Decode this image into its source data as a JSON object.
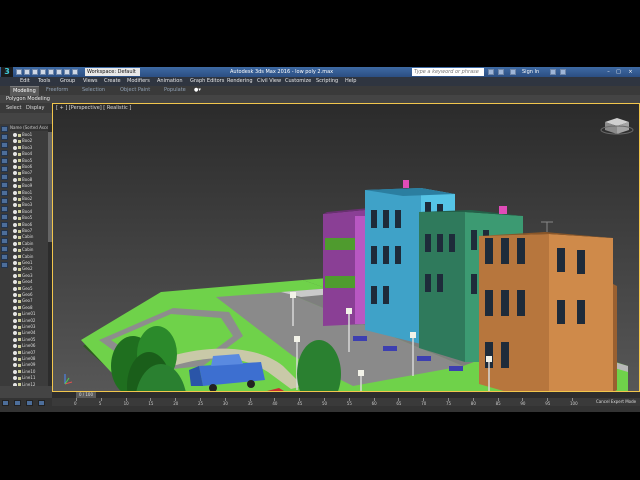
{
  "titlebar": {
    "logo": "3",
    "workspace": "Workspace: Default",
    "title": "Autodesk 3ds Max 2016 - low poly 2.max",
    "search_placeholder": "Type a keyword or phrase",
    "signin": "Sign In"
  },
  "menu": [
    "Edit",
    "Tools",
    "Group",
    "Views",
    "Create",
    "Modifiers",
    "Animation",
    "Graph Editors",
    "Rendering",
    "Civil View",
    "Customize",
    "Scripting",
    "Help"
  ],
  "ribbon": {
    "tabs": [
      "Modeling",
      "Freeform",
      "Selection",
      "Object Paint",
      "Populate"
    ],
    "panel": "Polygon Modeling"
  },
  "scene_explorer": {
    "tabs": [
      "Select",
      "Display"
    ],
    "header": "Name (Sorted Ascen",
    "rows": [
      "Boo1",
      "Boo2",
      "Boo3",
      "Boo4",
      "Boo5",
      "Boo6",
      "Boo7",
      "Boo8",
      "Boo9",
      "Boo1",
      "Boo2",
      "Boo3",
      "Boo4",
      "Boo5",
      "Boo6",
      "Boo7",
      "Cabin",
      "Cabin",
      "Cabin",
      "Cabin",
      "Geo1",
      "Geo2",
      "Geo3",
      "Geo4",
      "Geo5",
      "Geo6",
      "Geo7",
      "Geo8",
      "Line01",
      "Line02",
      "Line03",
      "Line04",
      "Line05",
      "Line06",
      "Line07",
      "Line08",
      "Line09",
      "Line10",
      "Line11",
      "Line12"
    ]
  },
  "viewport": {
    "label": "[ + ] [Perspective] [ Realistic ]"
  },
  "timeline": {
    "slider": "0 / 100",
    "ticks": [
      "0",
      "5",
      "10",
      "15",
      "20",
      "25",
      "30",
      "35",
      "40",
      "45",
      "50",
      "55",
      "60",
      "65",
      "70",
      "75",
      "80",
      "85",
      "90",
      "95",
      "100"
    ]
  },
  "status": {
    "cancel": "Cancel Expert Mode"
  },
  "colors": {
    "title_bar": "#3e6aa4",
    "grass": "#6fd24a",
    "road": "#8a8a8a",
    "building_blue": "#3fa2c8",
    "building_green": "#2f7a5c",
    "building_brown": "#b7763d",
    "building_purple": "#8a3f95",
    "car": "#3d6fd0"
  }
}
